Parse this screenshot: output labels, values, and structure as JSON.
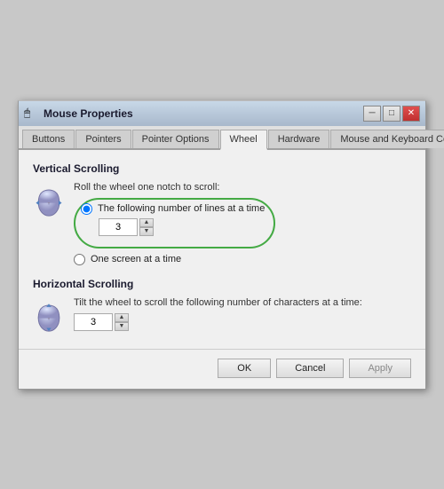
{
  "window": {
    "title": "Mouse Properties",
    "icon": "🖱"
  },
  "tabs": [
    {
      "label": "Buttons",
      "active": false
    },
    {
      "label": "Pointers",
      "active": false
    },
    {
      "label": "Pointer Options",
      "active": false
    },
    {
      "label": "Wheel",
      "active": true
    },
    {
      "label": "Hardware",
      "active": false
    },
    {
      "label": "Mouse and Keyboard Center",
      "active": false
    }
  ],
  "vertical_scrolling": {
    "section_title": "Vertical Scrolling",
    "roll_label": "Roll the wheel one notch to scroll:",
    "radio1_label": "The following number of lines at a time",
    "radio1_selected": true,
    "lines_value": "3",
    "radio2_label": "One screen at a time",
    "radio2_selected": false
  },
  "horizontal_scrolling": {
    "section_title": "Horizontal Scrolling",
    "tilt_label": "Tilt the wheel to scroll the following number of characters at a time:",
    "chars_value": "3"
  },
  "footer": {
    "ok_label": "OK",
    "cancel_label": "Cancel",
    "apply_label": "Apply"
  }
}
